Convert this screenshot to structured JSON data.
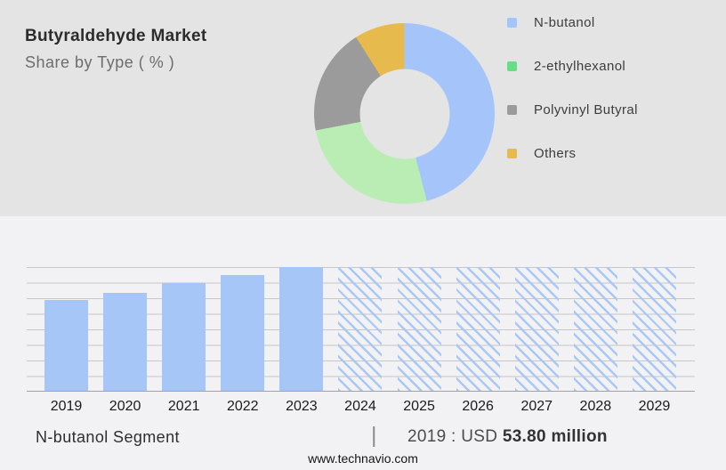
{
  "header": {
    "title": "Butyraldehyde Market",
    "subtitle": "Share by Type ( % )"
  },
  "colors": {
    "top_bg": "#e4e4e4",
    "bottom_bg": "#f2f2f4",
    "bar_blue": "#a6c6f8",
    "hatch_blue": "#a9c8f6",
    "gridline": "#c7c7c7",
    "baseline": "#a2a2a2"
  },
  "chart_data": [
    {
      "type": "pie",
      "subtype": "donut",
      "title": "Butyraldehyde Market — Share by Type ( % )",
      "legend_position": "right",
      "segments": [
        {
          "label": "N-butanol",
          "share_pct": 46,
          "color": "#a5c5fa",
          "legend_color": "#a5c5fa"
        },
        {
          "label": "2-ethylhexanol",
          "share_pct": 26,
          "color": "#b9edb3",
          "legend_color": "#65de86"
        },
        {
          "label": "Polyvinyl Butyral",
          "share_pct": 19,
          "color": "#9b9b9b",
          "legend_color": "#9b9b9b"
        },
        {
          "label": "Others",
          "share_pct": 9,
          "color": "#e6ba4c",
          "legend_color": "#e6ba4c"
        }
      ]
    },
    {
      "type": "bar",
      "title": "N-butanol Segment market size, 2019-2029",
      "categories": [
        "2019",
        "2020",
        "2021",
        "2022",
        "2023",
        "2024",
        "2025",
        "2026",
        "2027",
        "2028",
        "2029"
      ],
      "gridlines": true,
      "ylim_pct_of_max": [
        0,
        100
      ],
      "bars": [
        {
          "year": "2019",
          "height_pct": 73.6,
          "style": "solid",
          "est_value_usd_million": 53.8
        },
        {
          "year": "2020",
          "height_pct": 79.3,
          "style": "solid",
          "est_value_usd_million": 58.0
        },
        {
          "year": "2021",
          "height_pct": 87.1,
          "style": "solid",
          "est_value_usd_million": 63.7
        },
        {
          "year": "2022",
          "height_pct": 93.6,
          "style": "solid",
          "est_value_usd_million": 68.4
        },
        {
          "year": "2023",
          "height_pct": 100,
          "style": "solid",
          "est_value_usd_million": 73.1
        },
        {
          "year": "2024",
          "height_pct": 100,
          "style": "hatched"
        },
        {
          "year": "2025",
          "height_pct": 100,
          "style": "hatched"
        },
        {
          "year": "2026",
          "height_pct": 100,
          "style": "hatched"
        },
        {
          "year": "2027",
          "height_pct": 100,
          "style": "hatched"
        },
        {
          "year": "2028",
          "height_pct": 100,
          "style": "hatched"
        },
        {
          "year": "2029",
          "height_pct": 100,
          "style": "hatched"
        }
      ],
      "annotation": "2019 : USD 53.80 million"
    }
  ],
  "footer": {
    "segment_label": "N-butanol Segment",
    "separator": "|",
    "value_prefix": "2019 : USD",
    "value_bold": "53.80 million",
    "website": "www.technavio.com"
  }
}
